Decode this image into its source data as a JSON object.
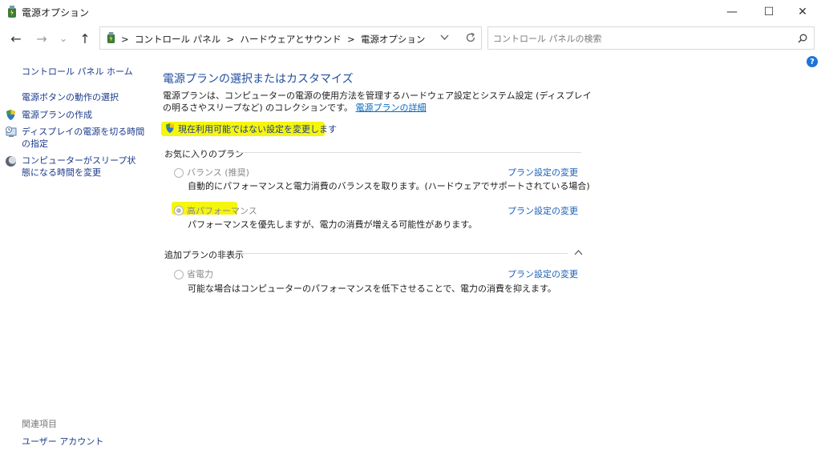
{
  "window": {
    "title": "電源オプション",
    "minimize": "—",
    "maximize": "☐",
    "close": "✕"
  },
  "nav": {
    "back": "←",
    "forward": "→",
    "recent": "⌄",
    "up": "↑"
  },
  "address": {
    "crumbs": [
      "コントロール パネル",
      "ハードウェアとサウンド",
      "電源オプション"
    ],
    "separator": ">"
  },
  "search": {
    "placeholder": "コントロール パネルの検索"
  },
  "left": {
    "home": "コントロール パネル ホーム",
    "items": [
      "電源ボタンの動作の選択",
      "電源プランの作成",
      "ディスプレイの電源を切る時間の指定",
      "コンピューターがスリープ状態になる時間を変更"
    ],
    "related_header": "関連項目",
    "related_items": [
      "ユーザー アカウント"
    ]
  },
  "main": {
    "heading": "電源プランの選択またはカスタマイズ",
    "description": "電源プランは、コンピューターの電源の使用方法を管理するハードウェア設定とシステム設定 (ディスプレイの明るさやスリープなど) のコレクションです。",
    "details_link": "電源プランの詳細",
    "change_settings_link": "現在利用可能ではない設定を変更します",
    "favorites_label": "お気に入りのプラン",
    "hidden_label": "追加プランの非表示",
    "plans": [
      {
        "name": "バランス (推奨)",
        "desc": "自動的にパフォーマンスと電力消費のバランスを取ります。(ハードウェアでサポートされている場合)",
        "link": "プラン設定の変更",
        "selected": false
      },
      {
        "name": "高パフォーマンス",
        "desc": "パフォーマンスを優先しますが、電力の消費が増える可能性があります。",
        "link": "プラン設定の変更",
        "selected": true
      },
      {
        "name": "省電力",
        "desc": "可能な場合はコンピューターのパフォーマンスを低下させることで、電力の消費を抑えます。",
        "link": "プラン設定の変更",
        "selected": false
      }
    ]
  },
  "colors": {
    "highlight": "#f5f50e",
    "link": "#1b5fb5",
    "heading": "#1f4e9c"
  }
}
